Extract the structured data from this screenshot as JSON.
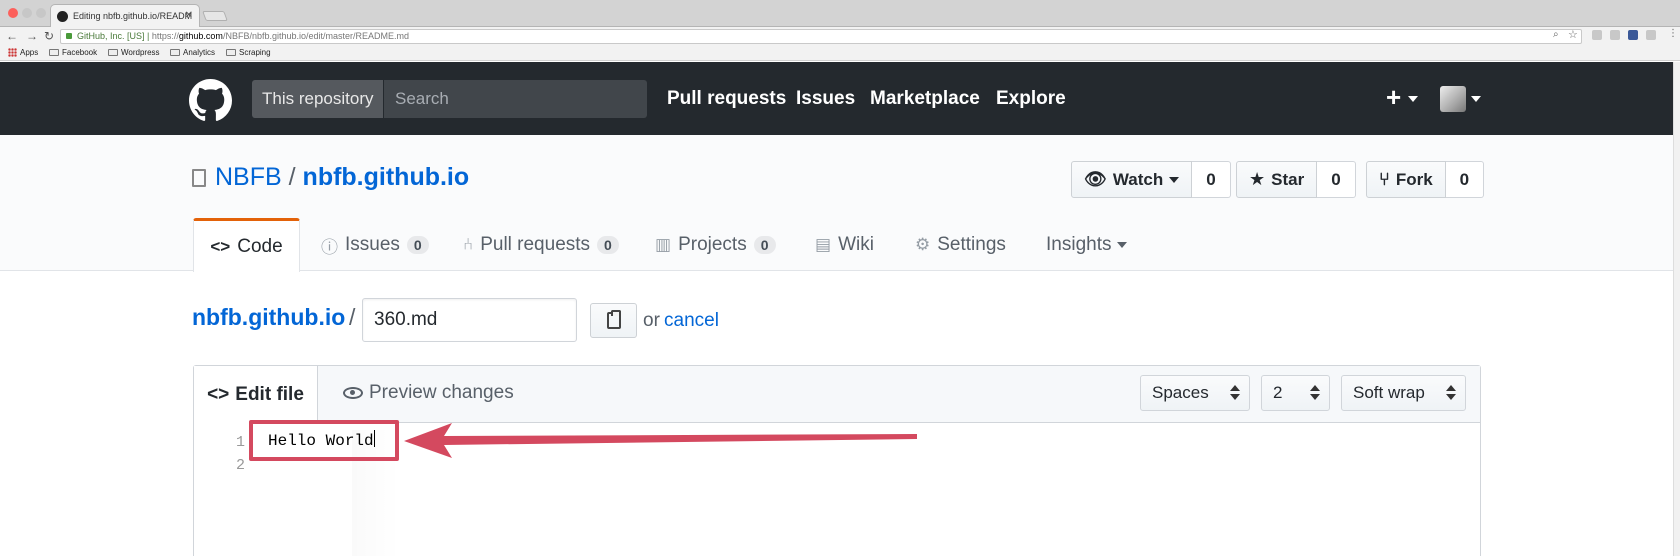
{
  "browser": {
    "tab_title": "Editing nbfb.github.io/READM",
    "url_secure_label": "GitHub, Inc. [US]",
    "url_scheme": "https://",
    "url_domain": "github.com",
    "url_path": "/NBFB/nbfb.github.io/edit/master/README.md",
    "bookmarks": [
      {
        "label": "Apps",
        "icon": "apps-grid-icon"
      },
      {
        "label": "Facebook",
        "icon": "folder-icon"
      },
      {
        "label": "Wordpress",
        "icon": "folder-icon"
      },
      {
        "label": "Analytics",
        "icon": "folder-icon"
      },
      {
        "label": "Scraping",
        "icon": "folder-icon"
      }
    ]
  },
  "header": {
    "scope_label": "This repository",
    "search_placeholder": "Search",
    "nav": [
      "Pull requests",
      "Issues",
      "Marketplace",
      "Explore"
    ],
    "plus_label": "+"
  },
  "repo": {
    "owner": "NBFB",
    "separator": "/",
    "name": "nbfb.github.io",
    "watch": {
      "label": "Watch",
      "count": "0"
    },
    "star": {
      "label": "Star",
      "count": "0"
    },
    "fork": {
      "label": "Fork",
      "count": "0"
    },
    "tabs": [
      {
        "label": "Code",
        "icon": "code-icon"
      },
      {
        "label": "Issues",
        "count": "0",
        "icon": "issue-icon"
      },
      {
        "label": "Pull requests",
        "count": "0",
        "icon": "pull-request-icon"
      },
      {
        "label": "Projects",
        "count": "0",
        "icon": "project-icon"
      },
      {
        "label": "Wiki",
        "icon": "wiki-icon"
      },
      {
        "label": "Settings",
        "icon": "gear-icon"
      },
      {
        "label": "Insights",
        "icon": "chevron-down-icon"
      }
    ]
  },
  "editor": {
    "breadcrumb_repo": "nbfb.github.io",
    "breadcrumb_sep": "/",
    "filename": "360.md",
    "or_text": "or",
    "cancel_label": "cancel",
    "tab_edit": "Edit file",
    "tab_preview": "Preview changes",
    "indent_mode": "Spaces",
    "indent_size": "2",
    "wrap_mode": "Soft wrap",
    "line_numbers": [
      "1",
      "2"
    ],
    "lines": [
      "Hello World",
      ""
    ]
  },
  "annotation": {
    "highlight_color": "#d4495f"
  }
}
